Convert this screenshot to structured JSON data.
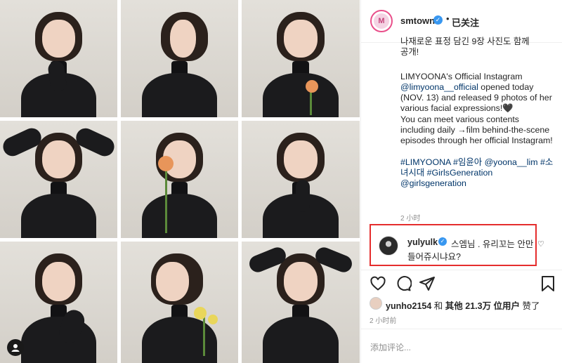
{
  "post": {
    "photos": [
      {
        "pose": "hand-on-chin"
      },
      {
        "pose": "profile"
      },
      {
        "pose": "orange-rose",
        "flower": "orange"
      },
      {
        "pose": "hands-on-head"
      },
      {
        "pose": "orange-rose-eyes-closed",
        "flower": "orange"
      },
      {
        "pose": "finger-on-chin"
      },
      {
        "pose": "hand-on-shoulder"
      },
      {
        "pose": "yellow-lily",
        "flower": "yellow"
      },
      {
        "pose": "hands-on-head-pout"
      }
    ]
  },
  "header": {
    "username": "smtown",
    "avatar_letter": "M",
    "dot": "•",
    "follow_status": "已关注"
  },
  "caption": {
    "korean_cut": "나재로운 표정 담긴 9장 사진도 함께\n공개!",
    "para1_prefix": "LIMYOONA's Official Instagram",
    "para1_mention": "@limyoona__official",
    "para1_rest": " opened today (NOV. 13) and released 9 photos of her various facial expressions!🖤\nYou can meet various contents including daily →film behind-the-scene episodes through her official Instagram!",
    "hashtags": "#LIMYOONA #임윤아 @yoona__lim #소녀시대 #GirlsGeneration @girlsgeneration",
    "time": "2 小时"
  },
  "comment": {
    "username": "yulyulk",
    "text_line1": "스엠님 . 유리꼬는 안만",
    "text_line2": "들어쥬시냐요?"
  },
  "likes": {
    "user": "yunho2154",
    "text": " 和 ",
    "others": "其他 21.3万 位用户",
    "suffix": " 赞了"
  },
  "time2": "2 小时前",
  "add_comment_placeholder": "添加评论...",
  "colors": {
    "verified": "#3897f0",
    "link": "#003569",
    "highlight_border": "#e52d2d",
    "meta_text": "#8e8e8e"
  }
}
